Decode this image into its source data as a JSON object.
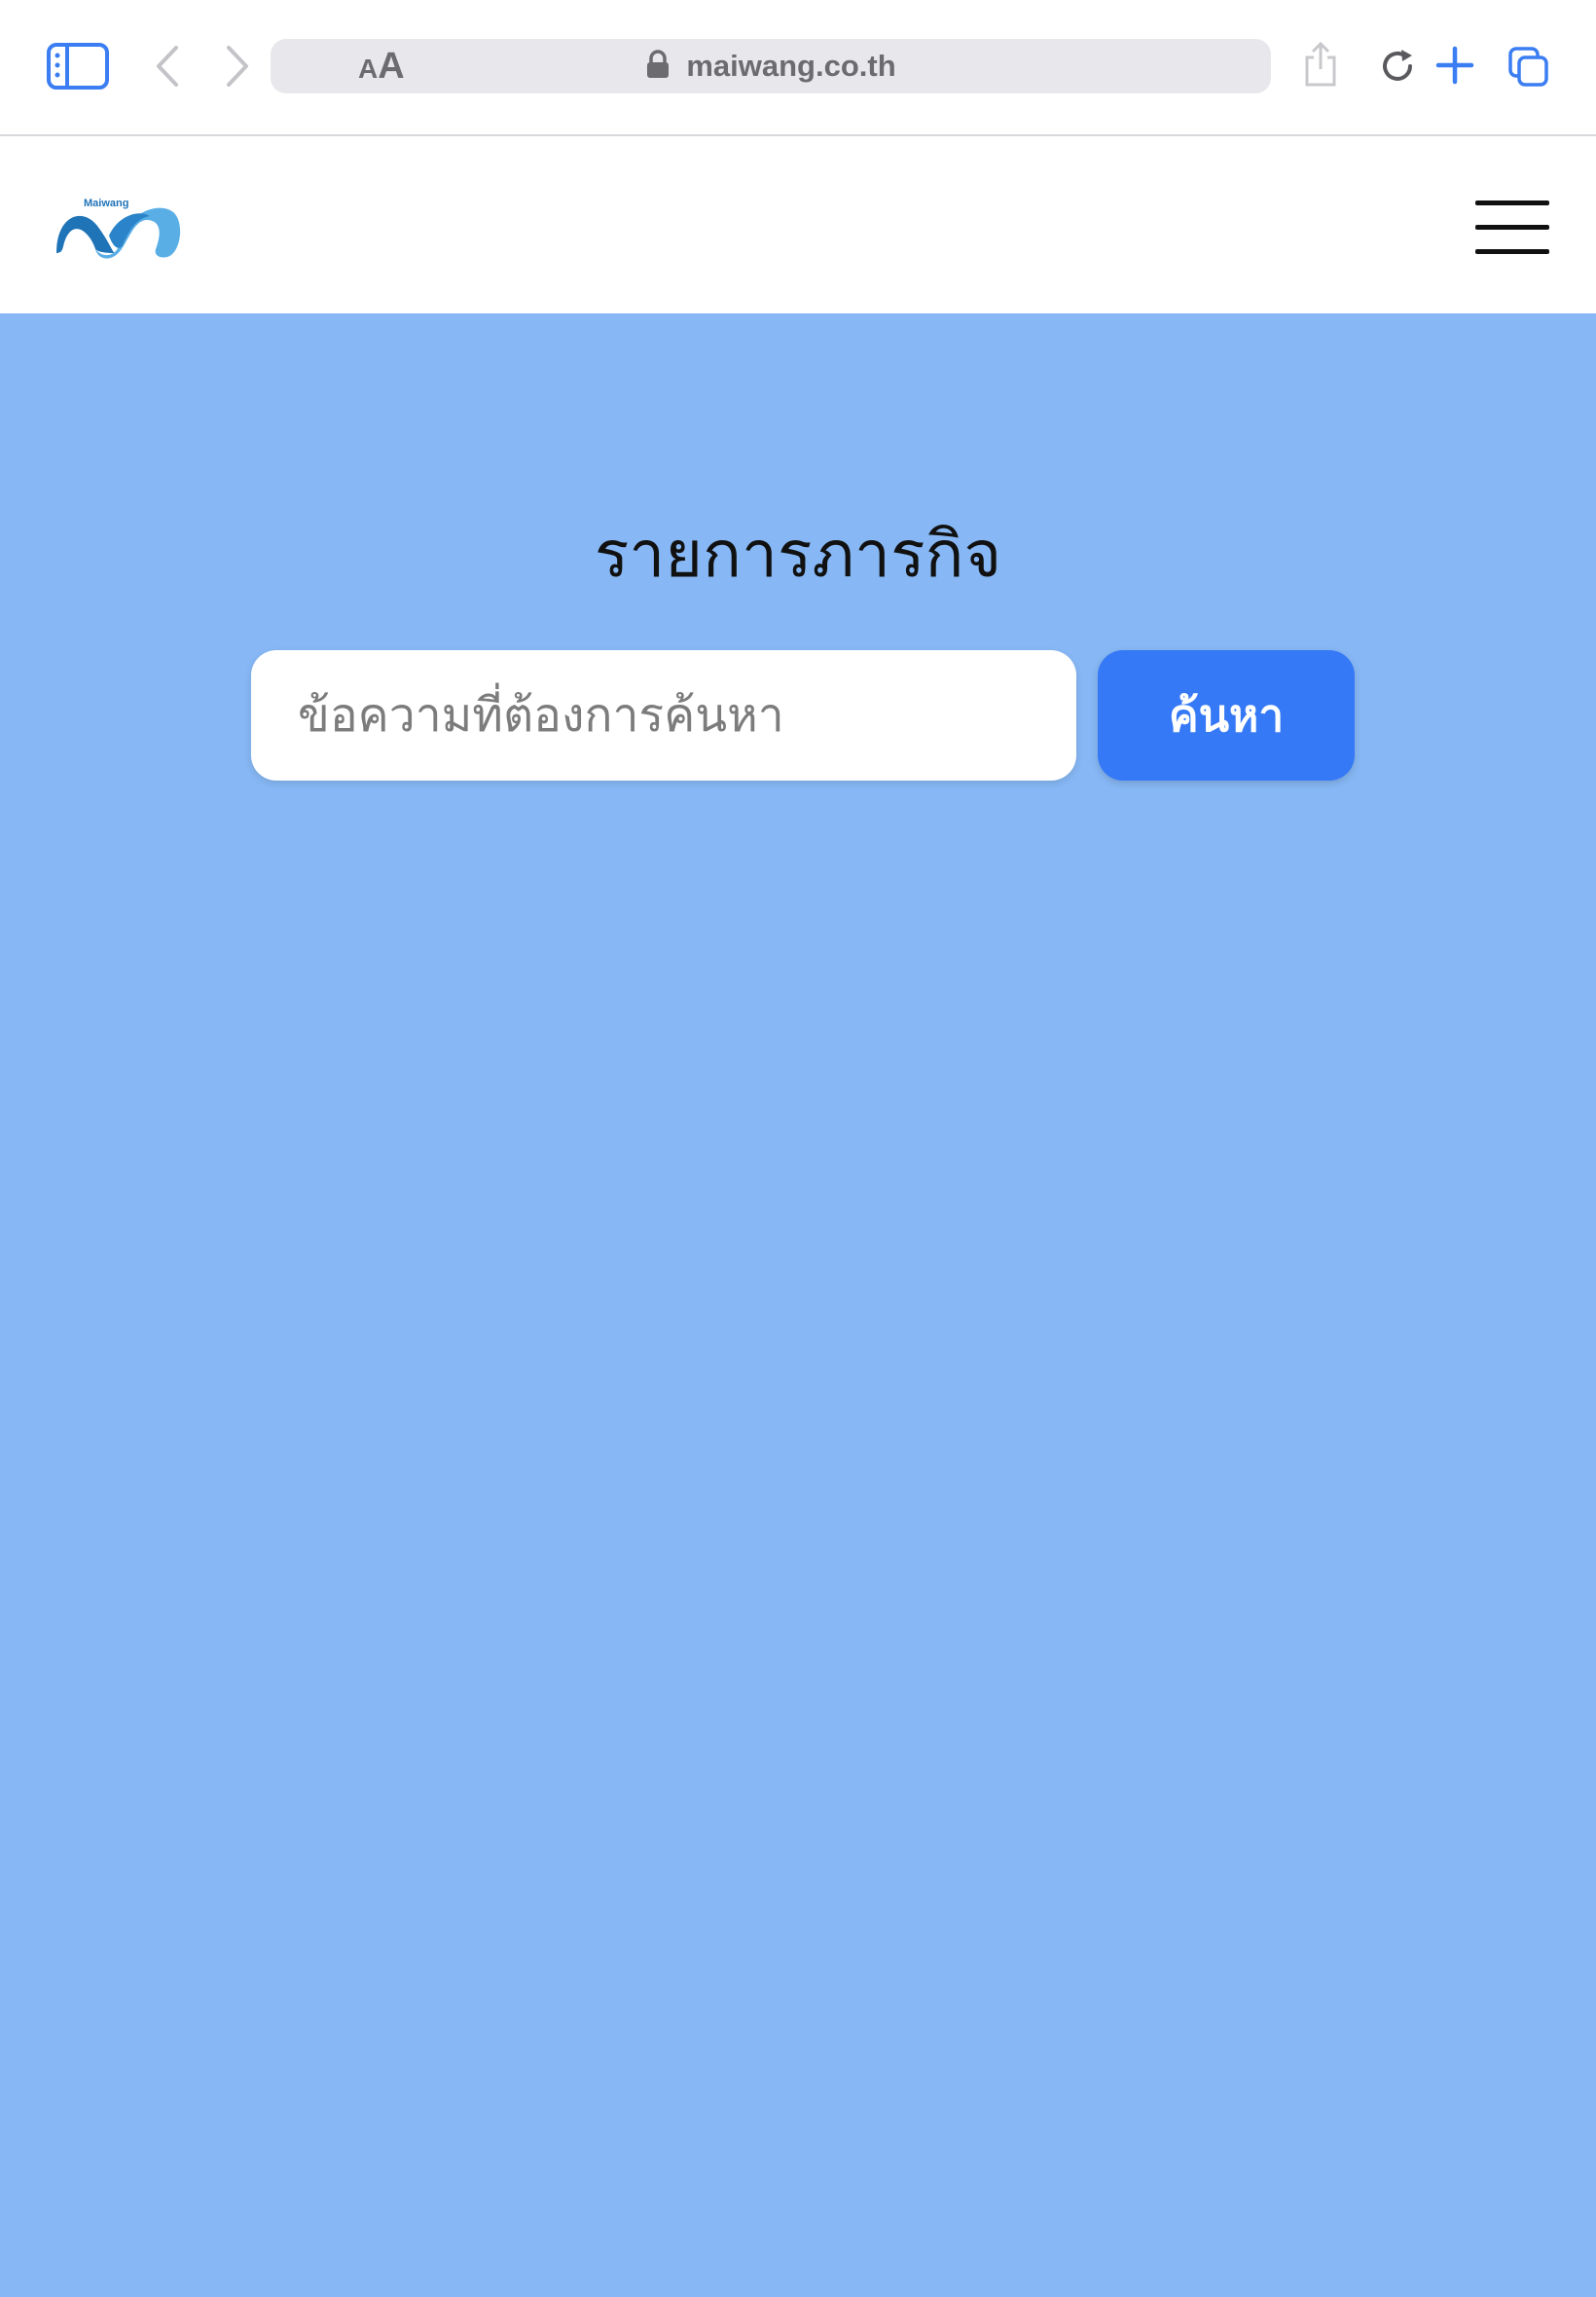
{
  "browser": {
    "url": "maiwang.co.th",
    "reader_small": "A",
    "reader_big": "A",
    "accent_color": "#3579f6"
  },
  "header": {
    "logo_text": "Maiwang"
  },
  "main": {
    "title": "รายการภารกิจ",
    "search": {
      "placeholder": "ข้อความที่ต้องการค้นหา",
      "value": "",
      "button_label": "ค้นหา"
    }
  },
  "colors": {
    "page_background": "#87b8f5",
    "button_background": "#3579f6"
  }
}
